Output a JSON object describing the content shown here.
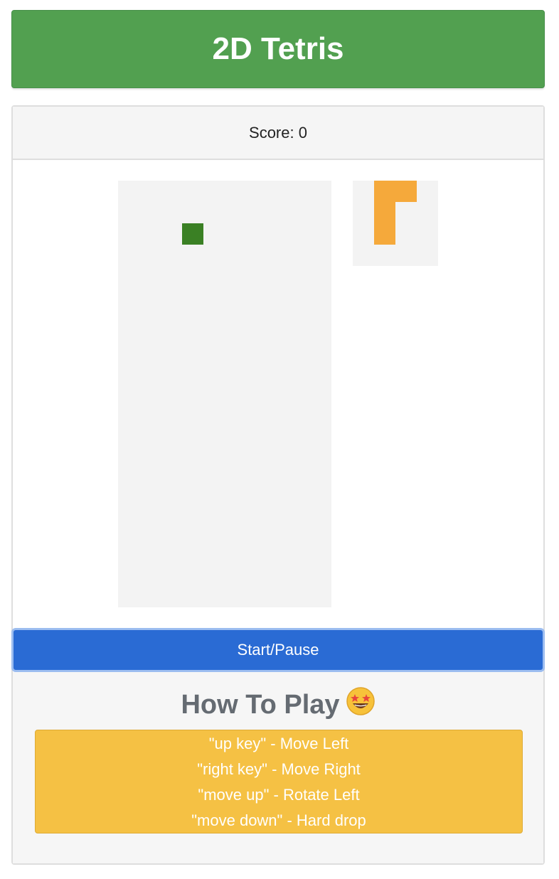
{
  "header": {
    "title": "2D Tetris"
  },
  "score": {
    "label": "Score:",
    "value": "0"
  },
  "board": {
    "columns": 10,
    "rows": 20,
    "background": "#f3f3f3",
    "filled_cells": [
      {
        "col": 3,
        "row": 2,
        "color": "#3a8024"
      }
    ]
  },
  "next_piece": {
    "columns": 4,
    "rows": 4,
    "background": "#f3f3f3",
    "piece_color": "#f5a93b",
    "filled_cells": [
      {
        "col": 1,
        "row": 0
      },
      {
        "col": 2,
        "row": 0
      },
      {
        "col": 1,
        "row": 1
      },
      {
        "col": 1,
        "row": 2
      }
    ]
  },
  "controls": {
    "start_pause_label": "Start/Pause"
  },
  "how_to_play": {
    "title": "How To Play",
    "emoji_icon": "star-struck-face-icon",
    "instructions": [
      "\"up key\" - Move Left",
      "\"right key\" - Move Right",
      "\"move up\" - Rotate Left",
      "\"move down\" - Hard drop"
    ]
  },
  "colors": {
    "header_green": "#52a050",
    "button_blue": "#2a6bd4",
    "instructions_yellow": "#f5c144",
    "title_gray": "#656b72"
  }
}
